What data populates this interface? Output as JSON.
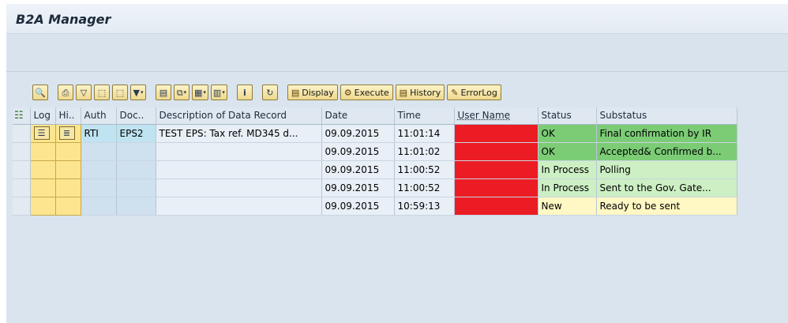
{
  "window": {
    "title": "B2A Manager"
  },
  "toolbar": {
    "icon_buttons": [
      {
        "name": "details-icon",
        "glyph": "🔍"
      },
      {
        "name": "print-icon",
        "glyph": "⎙"
      },
      {
        "name": "filter-icon",
        "glyph": "▽"
      },
      {
        "name": "find-icon",
        "glyph": "⛁"
      },
      {
        "name": "find-next-icon",
        "glyph": "⛶"
      },
      {
        "name": "set-filter-icon",
        "glyph": "▼"
      },
      {
        "name": "export-icon",
        "glyph": "▤"
      },
      {
        "name": "spreadsheet-icon",
        "glyph": "⧉"
      },
      {
        "name": "layout-icon",
        "glyph": "▦"
      },
      {
        "name": "columns-icon",
        "glyph": "▥"
      },
      {
        "name": "info-icon",
        "glyph": "i"
      },
      {
        "name": "refresh-icon",
        "glyph": "↻"
      }
    ],
    "text_buttons": {
      "display": "Display",
      "execute": "Execute",
      "history": "History",
      "errorlog": "ErrorLog"
    }
  },
  "grid": {
    "headers": {
      "log": "Log",
      "hi": "Hi..",
      "auth": "Auth",
      "doc": "Doc..",
      "desc": "Description of Data Record",
      "date": "Date",
      "time": "Time",
      "user": "User Name",
      "status": "Status",
      "substatus": "Substatus"
    },
    "rows": [
      {
        "auth": "RTI",
        "doc": "EPS2",
        "desc": "TEST EPS: Tax ref. MD345 d...",
        "date": "09.09.2015",
        "time": "11:01:14",
        "status": "OK",
        "substatus": "Final confirmation by IR"
      },
      {
        "auth": "",
        "doc": "",
        "desc": "",
        "date": "09.09.2015",
        "time": "11:01:02",
        "status": "OK",
        "substatus": "Accepted& Confirmed b..."
      },
      {
        "auth": "",
        "doc": "",
        "desc": "",
        "date": "09.09.2015",
        "time": "11:00:52",
        "status": "In Process",
        "substatus": "Polling"
      },
      {
        "auth": "",
        "doc": "",
        "desc": "",
        "date": "09.09.2015",
        "time": "11:00:52",
        "status": "In Process",
        "substatus": "Sent to the Gov. Gate..."
      },
      {
        "auth": "",
        "doc": "",
        "desc": "",
        "date": "09.09.2015",
        "time": "10:59:13",
        "status": "New",
        "substatus": "Ready to be sent"
      }
    ]
  },
  "colors": {
    "ok": "#7ccc76",
    "in_process": "#cdefc4",
    "new": "#fff7c4",
    "redaction": "#ec1c24"
  }
}
